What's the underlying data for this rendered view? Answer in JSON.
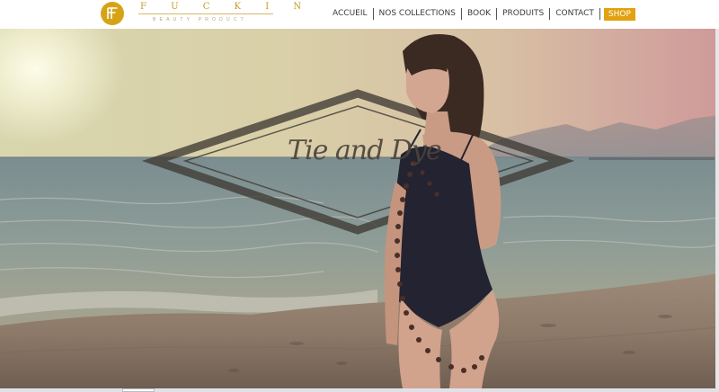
{
  "brand": {
    "monogram": "FF",
    "name": "F U C K I N",
    "tagline": "BEAUTY PRODUCT",
    "color": "#d7a316"
  },
  "nav": {
    "items": [
      {
        "label": "ACCUEIL"
      },
      {
        "label": "NOS COLLECTIONS"
      },
      {
        "label": "BOOK"
      },
      {
        "label": "PRODUITS"
      },
      {
        "label": "CONTACT"
      }
    ],
    "shop_label": "SHOP",
    "shop_color": "#e2a20f"
  },
  "hero": {
    "title": "Tie and Dye",
    "scene": "beach-photo"
  }
}
